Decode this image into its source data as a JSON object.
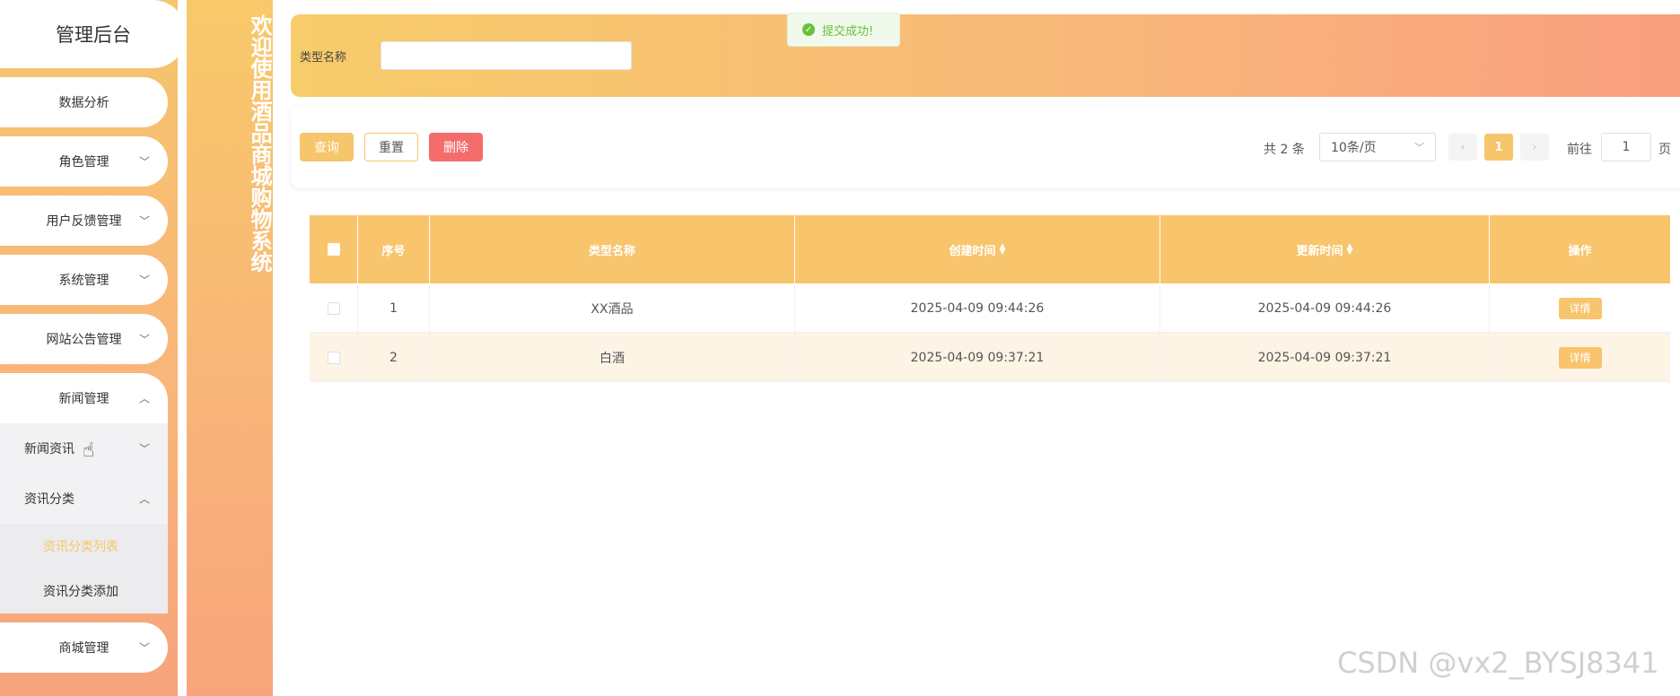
{
  "sidebar": {
    "title": "管理后台",
    "items": [
      {
        "label": "数据分析",
        "chevron": ""
      },
      {
        "label": "角色管理",
        "chevron": "⌄"
      },
      {
        "label": "用户反馈管理",
        "chevron": "⌄"
      },
      {
        "label": "系统管理",
        "chevron": "⌄"
      },
      {
        "label": "网站公告管理",
        "chevron": "⌄"
      },
      {
        "label": "新闻管理",
        "chevron": "⌃"
      }
    ],
    "news_sub": {
      "news_info": "新闻资讯",
      "category": "资讯分类",
      "category_list": "资讯分类列表",
      "category_add": "资讯分类添加"
    },
    "shop": "商城管理"
  },
  "banner": {
    "text": "欢迎使用酒品商城购物系统"
  },
  "search": {
    "label": "类型名称",
    "value": ""
  },
  "toast": {
    "text": "提交成功!"
  },
  "toolbar": {
    "query": "查询",
    "reset": "重置",
    "delete": "删除"
  },
  "pager": {
    "total": "共 2 条",
    "size": "10条/页",
    "current": "1",
    "goto": "前往",
    "goto_value": "1",
    "page_unit": "页"
  },
  "table": {
    "headers": [
      "序号",
      "类型名称",
      "创建时间",
      "更新时间",
      "操作"
    ],
    "rows": [
      {
        "no": "1",
        "name": "XX酒品",
        "created": "2025-04-09 09:44:26",
        "updated": "2025-04-09 09:44:26",
        "action": "详情"
      },
      {
        "no": "2",
        "name": "白酒",
        "created": "2025-04-09 09:37:21",
        "updated": "2025-04-09 09:37:21",
        "action": "详情"
      }
    ]
  },
  "watermark": "CSDN @vx2_BYSJ8341",
  "colors": {
    "accent": "#f7c56b",
    "danger": "#f56c6c",
    "success": "#67c23a",
    "active_menu": "#f7c56b"
  }
}
